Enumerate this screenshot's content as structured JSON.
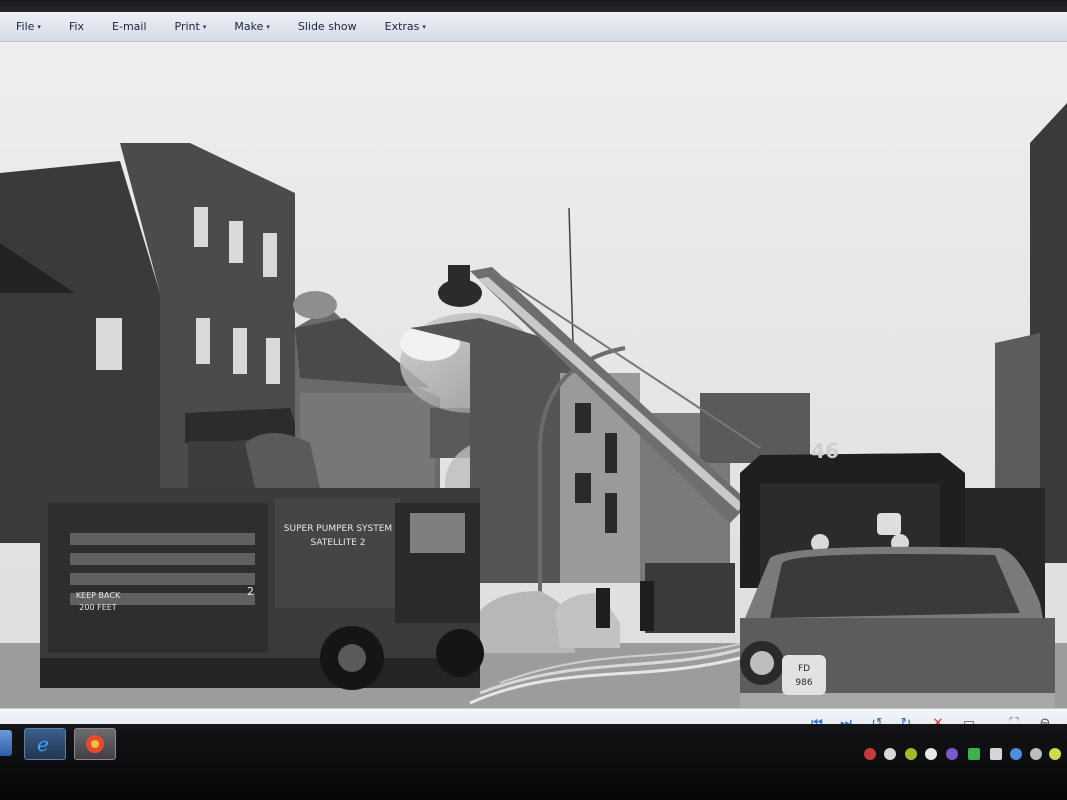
{
  "menu": {
    "items": [
      {
        "label": "File",
        "has_caret": true
      },
      {
        "label": "Fix",
        "has_caret": false
      },
      {
        "label": "E-mail",
        "has_caret": false
      },
      {
        "label": "Print",
        "has_caret": true
      },
      {
        "label": "Make",
        "has_caret": true
      },
      {
        "label": "Slide show",
        "has_caret": false
      },
      {
        "label": "Extras",
        "has_caret": true
      }
    ],
    "caret_glyph": "▾"
  },
  "photo": {
    "truck_text_line1": "SUPER PUMPER SYSTEM",
    "truck_text_line2": "SATELLITE 2",
    "truck_side_line1": "KEEP BACK",
    "truck_side_line2": "200 FEET",
    "truck_number": "2",
    "truck_front_number": "46",
    "car_badge_top": "FD",
    "car_badge_num": "986"
  },
  "toolbar": {
    "buttons": [
      {
        "name": "first-image-icon",
        "glyph": "⏮"
      },
      {
        "name": "last-image-icon",
        "glyph": "⏭"
      },
      {
        "name": "rotate-left-icon",
        "glyph": "↺"
      },
      {
        "name": "rotate-right-icon",
        "glyph": "↻"
      },
      {
        "name": "delete-icon",
        "glyph": "✕"
      },
      {
        "name": "monitor-icon",
        "glyph": "▭"
      },
      {
        "name": "fit-window-icon",
        "glyph": "⛶"
      },
      {
        "name": "zoom-icon",
        "glyph": "⊖"
      }
    ]
  },
  "colors": {
    "menu_text": "#1b2340",
    "toolbar_accent": "#2a6fd0",
    "delete_red": "#d23a2a"
  }
}
